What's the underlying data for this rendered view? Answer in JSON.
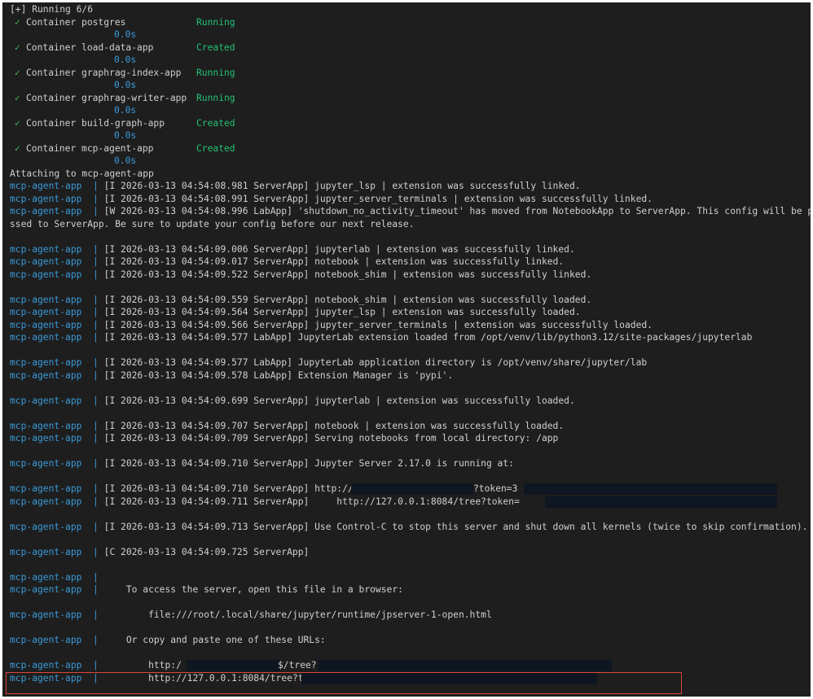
{
  "header": "[+] Running 6/6",
  "check_mark": "✓",
  "containers": [
    {
      "label": "Container postgres",
      "status": "Running",
      "time": "0.0s"
    },
    {
      "label": "Container load-data-app",
      "status": "Created",
      "time": "0.0s"
    },
    {
      "label": "Container graphrag-index-app",
      "status": "Running",
      "time": "0.0s"
    },
    {
      "label": "Container graphrag-writer-app",
      "status": "Running",
      "time": "0.0s"
    },
    {
      "label": "Container build-graph-app",
      "status": "Created",
      "time": "0.0s"
    },
    {
      "label": "Container mcp-agent-app",
      "status": "Created",
      "time": "0.0s"
    }
  ],
  "attaching": "Attaching to mcp-agent-app",
  "prefix": "mcp-agent-app",
  "separator": "|",
  "logs": [
    "[I 2026-03-13 04:54:08.981 ServerApp] jupyter_lsp | extension was successfully linked.",
    "[I 2026-03-13 04:54:08.991 ServerApp] jupyter_server_terminals | extension was successfully linked.",
    "[W 2026-03-13 04:54:08.996 LabApp] 'shutdown_no_activity_timeout' has moved from NotebookApp to ServerApp. This config will be pa",
    "ssed to ServerApp. Be sure to update your config before our next release.",
    "[I 2026-03-13 04:54:09.006 ServerApp] jupyterlab | extension was successfully linked.",
    "[I 2026-03-13 04:54:09.017 ServerApp] notebook | extension was successfully linked.",
    "[I 2026-03-13 04:54:09.522 ServerApp] notebook_shim | extension was successfully linked.",
    "[I 2026-03-13 04:54:09.559 ServerApp] notebook_shim | extension was successfully loaded.",
    "[I 2026-03-13 04:54:09.564 ServerApp] jupyter_lsp | extension was successfully loaded.",
    "[I 2026-03-13 04:54:09.566 ServerApp] jupyter_server_terminals | extension was successfully loaded.",
    "[I 2026-03-13 04:54:09.577 LabApp] JupyterLab extension loaded from /opt/venv/lib/python3.12/site-packages/jupyterlab",
    "[I 2026-03-13 04:54:09.577 LabApp] JupyterLab application directory is /opt/venv/share/jupyter/lab",
    "[I 2026-03-13 04:54:09.578 LabApp] Extension Manager is 'pypi'.",
    "[I 2026-03-13 04:54:09.699 ServerApp] jupyterlab | extension was successfully loaded.",
    "[I 2026-03-13 04:54:09.707 ServerApp] notebook | extension was successfully loaded.",
    "[I 2026-03-13 04:54:09.709 ServerApp] Serving notebooks from local directory: /app",
    "[I 2026-03-13 04:54:09.710 ServerApp] Jupyter Server 2.17.0 is running at:",
    "[I 2026-03-13 04:54:09.710 ServerApp] http://(",
    "[I 2026-03-13 04:54:09.711 ServerApp]     http://127.0.0.1:8084/tree?token=",
    "[I 2026-03-13 04:54:09.713 ServerApp] Use Control-C to stop this server and shut down all kernels (twice to skip confirmation).",
    "[C 2026-03-13 04:54:09.725 ServerApp]",
    "",
    "    To access the server, open this file in a browser:",
    "        file:///root/.local/share/jupyter/runtime/jpserver-1-open.html",
    "    Or copy and paste one of these URLs:",
    "        http:/",
    "        http://127.0.0.1:8084/tree?t"
  ],
  "token_fragments": {
    "line1": "?token=3",
    "line_url1": "$/tree?"
  }
}
